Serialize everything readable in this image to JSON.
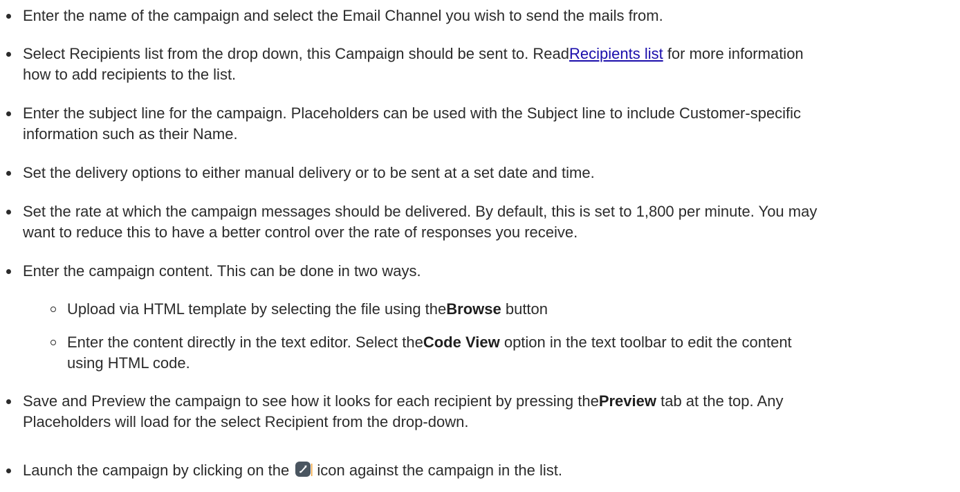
{
  "items": [
    {
      "text": "Enter the name of the campaign and select the Email Channel you wish to send the mails from."
    },
    {
      "text_before": "Select Recipients list from the drop down, this Campaign should be sent to. Read",
      "link": "Recipients list",
      "text_after": " for more information",
      "line2": "how to add recipients to the list."
    },
    {
      "line1": "Enter the subject line for the campaign. Placeholders can be used with the Subject line to include Customer-specific",
      "line2": "information such as their Name."
    },
    {
      "text": "Set the delivery options to either manual delivery or to be sent at a set date and time."
    },
    {
      "line1": "Set the rate at which the campaign messages should be delivered. By default, this is set to 1,800 per minute. You may",
      "line2": "want to reduce this to have a better control over the rate of responses you receive."
    },
    {
      "text": "Enter the campaign content. This can be done in two ways.",
      "sub": [
        {
          "before": "Upload via HTML template by selecting the file using the",
          "bold": "Browse",
          "after": " button"
        },
        {
          "before": "Enter the content directly in the text editor. Select the",
          "bold": "Code View",
          "after": " option in the text toolbar to edit the content",
          "line2": "using HTML code."
        }
      ]
    },
    {
      "before": "Save and Preview the campaign to see how it looks for each recipient by pressing the",
      "bold": "Preview",
      "after": " tab at the top. Any",
      "line2": "Placeholders will load for the select Recipient from the drop-down."
    },
    {
      "before": "Launch the campaign by clicking on the ",
      "icon": "rocket-launch-icon",
      "after": "icon against the campaign in the list."
    }
  ],
  "colors": {
    "text": "#2b2b2b",
    "link": "#1a0dab",
    "icon_bg": "#4a5560",
    "icon_accent": "#f2a33a"
  }
}
